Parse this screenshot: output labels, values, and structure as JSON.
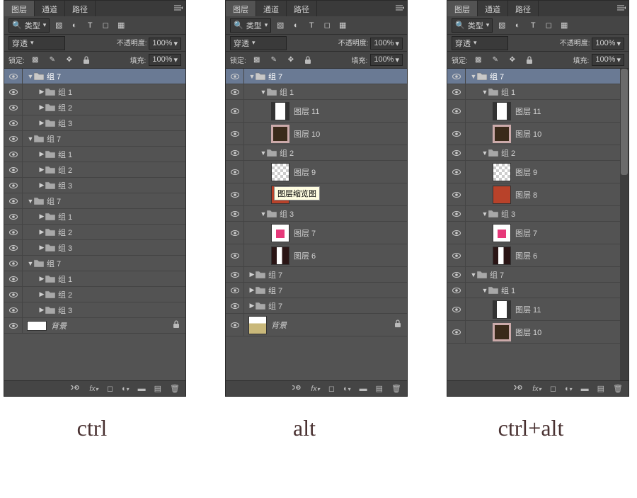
{
  "tabs": {
    "layers": "图层",
    "channels": "通道",
    "paths": "路径"
  },
  "toolbar": {
    "search_icon": "🔍",
    "kind_label": "类型"
  },
  "blend": {
    "mode": "穿透",
    "opacity_label": "不透明度:",
    "opacity_value": "100%",
    "lock_label": "锁定:",
    "fill_label": "填充:",
    "fill_value": "100%"
  },
  "names": {
    "group7": "组 7",
    "group1": "组 1",
    "group2": "组 2",
    "group3": "组 3",
    "layer11": "图层 11",
    "layer10": "图层 10",
    "layer9": "图层 9",
    "layer8": "图层 8",
    "layer7": "图层 7",
    "layer6": "图层 6",
    "background": "背景"
  },
  "tooltip": "图层缩览图",
  "captions": {
    "ctrl": "ctrl",
    "alt": "alt",
    "ctrlalt": "ctrl+alt"
  },
  "panels": [
    {
      "id": "panel-ctrl",
      "layers": [
        {
          "type": "group",
          "name": "group7",
          "depth": 0,
          "sel": true,
          "open": true
        },
        {
          "type": "group",
          "name": "group1",
          "depth": 1,
          "open": false
        },
        {
          "type": "group",
          "name": "group2",
          "depth": 1,
          "open": false
        },
        {
          "type": "group",
          "name": "group3",
          "depth": 1,
          "open": false
        },
        {
          "type": "group",
          "name": "group7",
          "depth": 0,
          "open": true
        },
        {
          "type": "group",
          "name": "group1",
          "depth": 1,
          "open": false
        },
        {
          "type": "group",
          "name": "group2",
          "depth": 1,
          "open": false
        },
        {
          "type": "group",
          "name": "group3",
          "depth": 1,
          "open": false
        },
        {
          "type": "group",
          "name": "group7",
          "depth": 0,
          "open": true
        },
        {
          "type": "group",
          "name": "group1",
          "depth": 1,
          "open": false
        },
        {
          "type": "group",
          "name": "group2",
          "depth": 1,
          "open": false
        },
        {
          "type": "group",
          "name": "group3",
          "depth": 1,
          "open": false
        },
        {
          "type": "group",
          "name": "group7",
          "depth": 0,
          "open": true
        },
        {
          "type": "group",
          "name": "group1",
          "depth": 1,
          "open": false
        },
        {
          "type": "group",
          "name": "group2",
          "depth": 1,
          "open": false
        },
        {
          "type": "group",
          "name": "group3",
          "depth": 1,
          "open": false
        },
        {
          "type": "bg",
          "name": "background",
          "depth": 0,
          "lock": true,
          "thumb": "white"
        }
      ]
    },
    {
      "id": "panel-alt",
      "layers": [
        {
          "type": "group",
          "name": "group7",
          "depth": 0,
          "sel": true,
          "open": true
        },
        {
          "type": "group",
          "name": "group1",
          "depth": 1,
          "open": true
        },
        {
          "type": "layer",
          "name": "layer11",
          "depth": 2,
          "thumb": "img1"
        },
        {
          "type": "layer",
          "name": "layer10",
          "depth": 2,
          "thumb": "img2"
        },
        {
          "type": "group",
          "name": "group2",
          "depth": 1,
          "open": true
        },
        {
          "type": "layer",
          "name": "layer9",
          "depth": 2,
          "thumb": "checker"
        },
        {
          "type": "layer",
          "name": "",
          "depth": 2,
          "thumb": "img3",
          "tooltip": true
        },
        {
          "type": "group",
          "name": "group3",
          "depth": 1,
          "open": true
        },
        {
          "type": "layer",
          "name": "layer7",
          "depth": 2,
          "thumb": "pink"
        },
        {
          "type": "layer",
          "name": "layer6",
          "depth": 2,
          "thumb": "img4"
        },
        {
          "type": "group",
          "name": "group7",
          "depth": 0,
          "open": false
        },
        {
          "type": "group",
          "name": "group7",
          "depth": 0,
          "open": false
        },
        {
          "type": "group",
          "name": "group7",
          "depth": 0,
          "open": false
        },
        {
          "type": "bg",
          "name": "background",
          "depth": 0,
          "lock": true,
          "thumb": "tan",
          "tall": true
        }
      ]
    },
    {
      "id": "panel-ctrlalt",
      "scroll": true,
      "layers": [
        {
          "type": "group",
          "name": "group7",
          "depth": 0,
          "sel": true,
          "open": true
        },
        {
          "type": "group",
          "name": "group1",
          "depth": 1,
          "open": true
        },
        {
          "type": "layer",
          "name": "layer11",
          "depth": 2,
          "thumb": "img1"
        },
        {
          "type": "layer",
          "name": "layer10",
          "depth": 2,
          "thumb": "img2"
        },
        {
          "type": "group",
          "name": "group2",
          "depth": 1,
          "open": true
        },
        {
          "type": "layer",
          "name": "layer9",
          "depth": 2,
          "thumb": "checker"
        },
        {
          "type": "layer",
          "name": "layer8",
          "depth": 2,
          "thumb": "img3"
        },
        {
          "type": "group",
          "name": "group3",
          "depth": 1,
          "open": true
        },
        {
          "type": "layer",
          "name": "layer7",
          "depth": 2,
          "thumb": "pink"
        },
        {
          "type": "layer",
          "name": "layer6",
          "depth": 2,
          "thumb": "img4"
        },
        {
          "type": "group",
          "name": "group7",
          "depth": 0,
          "open": true
        },
        {
          "type": "group",
          "name": "group1",
          "depth": 1,
          "open": true
        },
        {
          "type": "layer",
          "name": "layer11",
          "depth": 2,
          "thumb": "img1"
        },
        {
          "type": "layer",
          "name": "layer10",
          "depth": 2,
          "thumb": "img2"
        }
      ]
    }
  ]
}
